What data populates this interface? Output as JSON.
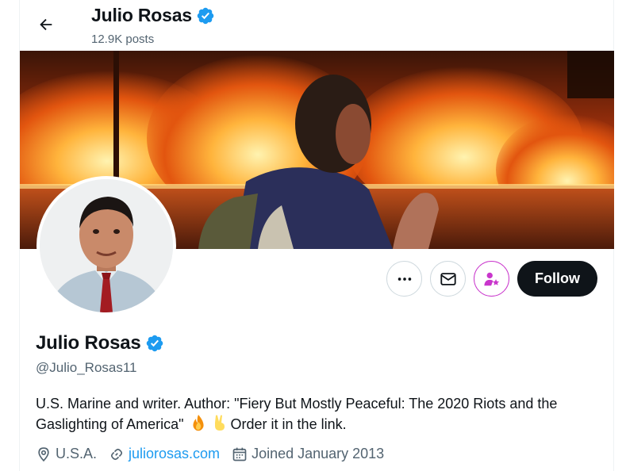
{
  "header": {
    "name": "Julio Rosas",
    "posts": "12.9K posts"
  },
  "profile": {
    "name": "Julio Rosas",
    "handle": "@Julio_Rosas11",
    "bio_line1": "U.S. Marine and writer. Author: \"Fiery But Mostly Peaceful: The 2020 Riots and the",
    "bio_line2_start": "Gaslighting of America\"",
    "bio_emojis": [
      "fire-emoji",
      "victory-hand-emoji"
    ],
    "bio_line2_end": "Order it in the link.",
    "location": "U.S.A.",
    "website": "juliorosas.com",
    "joined": "Joined January 2013"
  },
  "actions": {
    "more_icon": "more-icon",
    "message_icon": "envelope-icon",
    "subscribe_icon": "subscribe-star-icon",
    "follow_label": "Follow"
  },
  "colors": {
    "verified": "#1d9bf0",
    "link": "#1d9bf0",
    "follow_bg": "#0f1419",
    "subscribe_accent": "#c936cc",
    "secondary_text": "#536471"
  }
}
